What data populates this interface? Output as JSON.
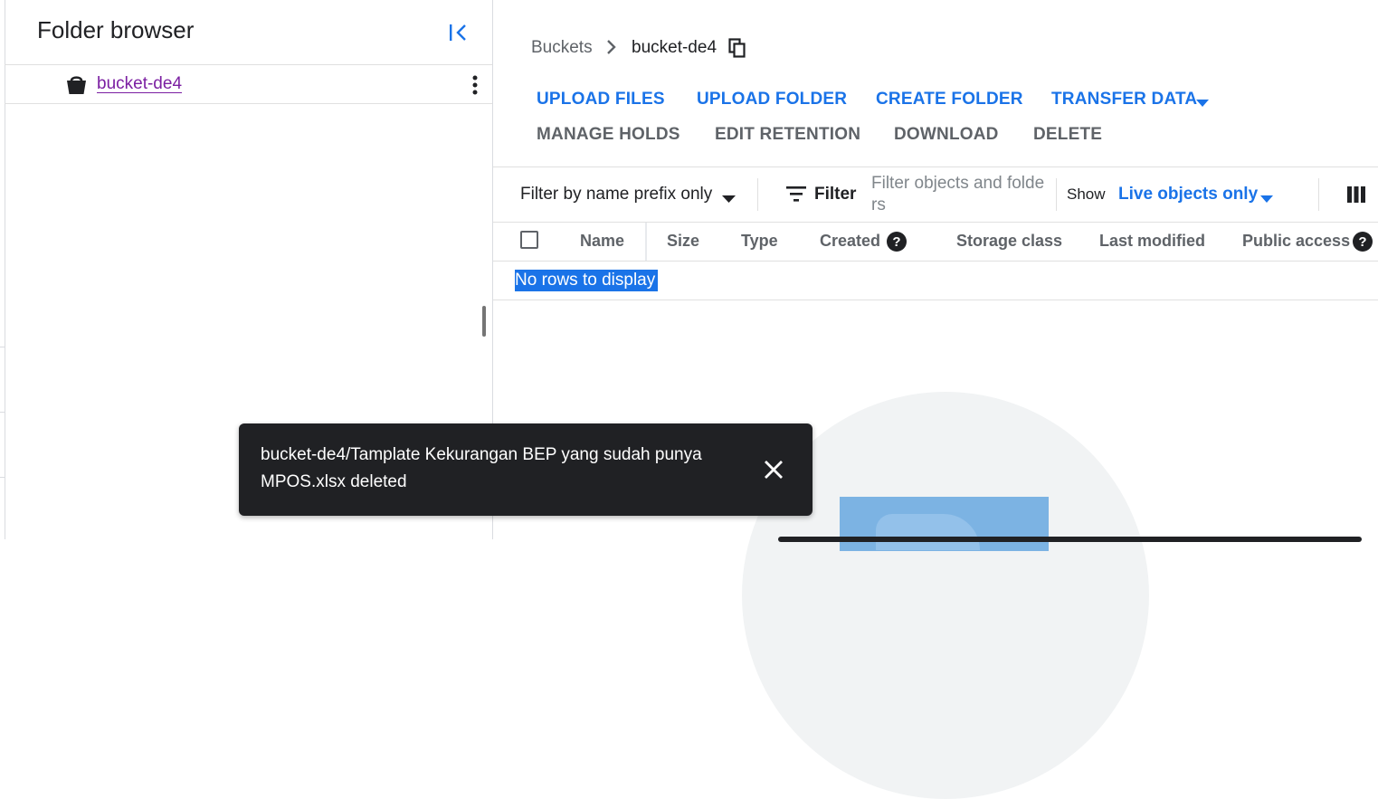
{
  "sidebar": {
    "title": "Folder browser",
    "bucket_label": "bucket-de4"
  },
  "breadcrumb": {
    "root": "Buckets",
    "current": "bucket-de4"
  },
  "actions": {
    "upload_files": "UPLOAD FILES",
    "upload_folder": "UPLOAD FOLDER",
    "create_folder": "CREATE FOLDER",
    "transfer_data": "TRANSFER DATA",
    "manage_holds": "MANAGE HOLDS",
    "edit_retention": "EDIT RETENTION",
    "download": "DOWNLOAD",
    "delete": "DELETE"
  },
  "filter_bar": {
    "prefix_mode": "Filter by name prefix only",
    "filter_label": "Filter",
    "filter_placeholder": "Filter objects and folders",
    "show_label": "Show",
    "show_value": "Live objects only"
  },
  "table": {
    "columns": [
      "Name",
      "Size",
      "Type",
      "Created",
      "Storage class",
      "Last modified",
      "Public access"
    ],
    "empty_text": "No rows to display"
  },
  "snackbar": {
    "message": "bucket-de4/Tamplate Kekurangan BEP yang sudah punya MPOS.xlsx deleted"
  },
  "colors": {
    "accent": "#1a73e8",
    "link_visited": "#7b1fa2",
    "snackbar_bg": "#202124"
  }
}
